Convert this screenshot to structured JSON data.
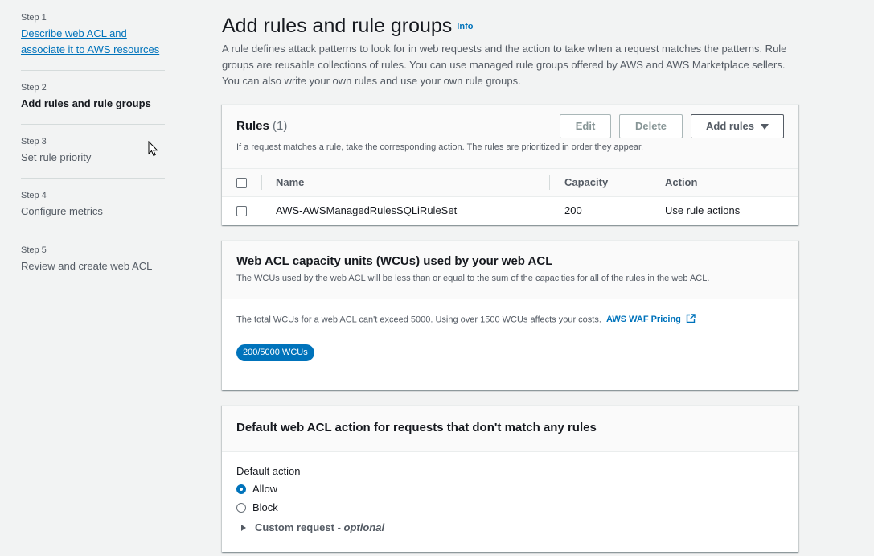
{
  "sidebar": {
    "steps": [
      {
        "num": "Step 1",
        "title": "Describe web ACL and associate it to AWS resources"
      },
      {
        "num": "Step 2",
        "title": "Add rules and rule groups"
      },
      {
        "num": "Step 3",
        "title": "Set rule priority"
      },
      {
        "num": "Step 4",
        "title": "Configure metrics"
      },
      {
        "num": "Step 5",
        "title": "Review and create web ACL"
      }
    ]
  },
  "main": {
    "title": "Add rules and rule groups",
    "info": "Info",
    "description": "A rule defines attack patterns to look for in web requests and the action to take when a request matches the patterns. Rule groups are reusable collections of rules. You can use managed rule groups offered by AWS and AWS Marketplace sellers. You can also write your own rules and use your own rule groups."
  },
  "rules": {
    "title": "Rules",
    "count": "(1)",
    "description": "If a request matches a rule, take the corresponding action. The rules are prioritized in order they appear.",
    "edit_label": "Edit",
    "delete_label": "Delete",
    "add_label": "Add rules",
    "columns": {
      "name": "Name",
      "capacity": "Capacity",
      "action": "Action"
    },
    "rows": [
      {
        "name": "AWS-AWSManagedRulesSQLiRuleSet",
        "capacity": "200",
        "action": "Use rule actions"
      }
    ]
  },
  "wcu": {
    "title": "Web ACL capacity units (WCUs) used by your web ACL",
    "description": "The WCUs used by the web ACL will be less than or equal to the sum of the capacities for all of the rules in the web ACL.",
    "text": "The total WCUs for a web ACL can't exceed 5000. Using over 1500 WCUs affects your costs.",
    "pricing_link": "AWS WAF Pricing",
    "badge": "200/5000 WCUs"
  },
  "default_action": {
    "title": "Default web ACL action for requests that don't match any rules",
    "label": "Default action",
    "options": [
      "Allow",
      "Block"
    ],
    "selected": "Allow",
    "custom_request": "Custom request - ",
    "optional": "optional"
  },
  "colors": {
    "accent": "#0073bb",
    "text": "#16191f",
    "muted": "#545b64",
    "background": "#f2f3f3"
  }
}
